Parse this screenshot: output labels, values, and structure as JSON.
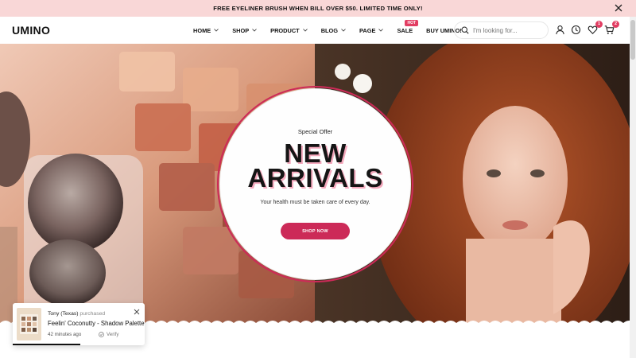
{
  "announcement": {
    "text": "FREE EYELINER BRUSH WHEN BILL OVER $50. LIMITED TIME ONLY!"
  },
  "header": {
    "logo": "UMINO",
    "nav": [
      {
        "label": "HOME",
        "has_dropdown": true
      },
      {
        "label": "SHOP",
        "has_dropdown": true
      },
      {
        "label": "PRODUCT",
        "has_dropdown": true
      },
      {
        "label": "BLOG",
        "has_dropdown": true
      },
      {
        "label": "PAGE",
        "has_dropdown": true
      },
      {
        "label": "SALE",
        "has_dropdown": false,
        "badge": "HOT"
      },
      {
        "label": "BUY UMINO!",
        "has_dropdown": false
      }
    ],
    "search": {
      "placeholder": "I'm looking for..."
    },
    "icons": {
      "account": "user-icon",
      "recent": "clock-icon",
      "wishlist": "heart-icon",
      "wishlist_count": "1",
      "cart": "cart-icon",
      "cart_count": "2"
    }
  },
  "hero": {
    "kicker": "Special Offer",
    "title_line1": "NEW",
    "title_line2": "ARRIVALS",
    "subtitle": "Your health must be taken care of every day.",
    "cta": "SHOP NOW",
    "accent_color": "#cc2a58"
  },
  "popup": {
    "buyer": "Tony (Texas)",
    "action": "purchased",
    "product": "Feelin' Coconutty - Shadow Palette",
    "time": "42 minutes ago",
    "verify": "Verify"
  }
}
